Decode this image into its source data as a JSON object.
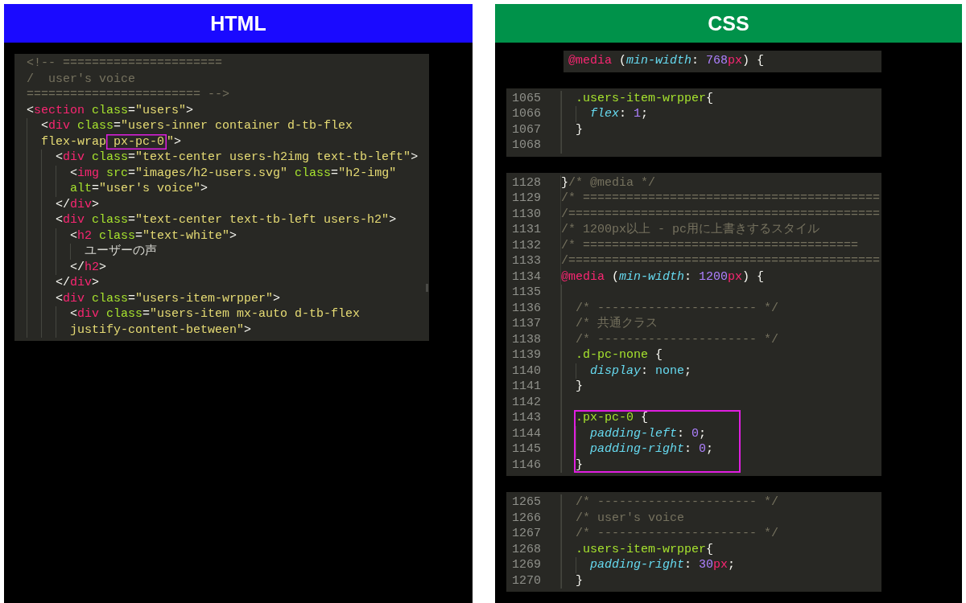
{
  "panes": [
    {
      "title": "HTML",
      "color": "#1a0aff",
      "kind": "markup",
      "snippets": [
        {
          "lines": [
            {
              "tokens": [
                {
                  "kind": "comment",
                  "text": "<!-- ======================"
                }
              ]
            },
            {
              "tokens": [
                {
                  "kind": "comment",
                  "text": "/  user's voice"
                }
              ]
            },
            {
              "tokens": [
                {
                  "kind": "comment",
                  "text": "======================== -->"
                }
              ]
            },
            {
              "tokens": [
                {
                  "kind": "punct",
                  "text": "<"
                },
                {
                  "kind": "tag",
                  "text": "section"
                },
                {
                  "kind": "attr",
                  "text": " class"
                },
                {
                  "kind": "punct",
                  "text": "="
                },
                {
                  "kind": "string",
                  "text": "\"users\""
                },
                {
                  "kind": "punct",
                  "text": ">"
                }
              ],
              "children": [
                {
                  "tokens": [
                    {
                      "kind": "punct",
                      "text": "<"
                    },
                    {
                      "kind": "tag",
                      "text": "div"
                    },
                    {
                      "kind": "attr",
                      "text": " class"
                    },
                    {
                      "kind": "punct",
                      "text": "="
                    },
                    {
                      "kind": "string",
                      "text": "\"users-inner container d-tb-flex"
                    }
                  ]
                },
                {
                  "tokens": [
                    {
                      "kind": "string",
                      "text": "flex-wrap"
                    },
                    {
                      "kind": "highlight",
                      "tokens": [
                        {
                          "kind": "string",
                          "text": " px-pc-0"
                        }
                      ]
                    },
                    {
                      "kind": "string",
                      "text": "\""
                    },
                    {
                      "kind": "punct",
                      "text": ">"
                    }
                  ],
                  "children": [
                    {
                      "tokens": [
                        {
                          "kind": "punct",
                          "text": "<"
                        },
                        {
                          "kind": "tag",
                          "text": "div"
                        },
                        {
                          "kind": "attr",
                          "text": " class"
                        },
                        {
                          "kind": "punct",
                          "text": "="
                        },
                        {
                          "kind": "string",
                          "text": "\"text-center users-h2img text-tb-left\""
                        },
                        {
                          "kind": "punct",
                          "text": ">"
                        }
                      ],
                      "children": [
                        {
                          "tokens": [
                            {
                              "kind": "punct",
                              "text": "<"
                            },
                            {
                              "kind": "tag",
                              "text": "img"
                            },
                            {
                              "kind": "attr",
                              "text": " src"
                            },
                            {
                              "kind": "punct",
                              "text": "="
                            },
                            {
                              "kind": "string",
                              "text": "\"images/h2-users.svg\""
                            },
                            {
                              "kind": "attr",
                              "text": " class"
                            },
                            {
                              "kind": "punct",
                              "text": "="
                            },
                            {
                              "kind": "string",
                              "text": "\"h2-img\""
                            }
                          ]
                        },
                        {
                          "tokens": [
                            {
                              "kind": "attr",
                              "text": "alt"
                            },
                            {
                              "kind": "punct",
                              "text": "="
                            },
                            {
                              "kind": "string",
                              "text": "\"user's voice\""
                            },
                            {
                              "kind": "punct",
                              "text": ">"
                            }
                          ]
                        }
                      ]
                    },
                    {
                      "tokens": [
                        {
                          "kind": "punct",
                          "text": "</"
                        },
                        {
                          "kind": "tag",
                          "text": "div"
                        },
                        {
                          "kind": "punct",
                          "text": ">"
                        }
                      ]
                    },
                    {
                      "tokens": [
                        {
                          "kind": "punct",
                          "text": "<"
                        },
                        {
                          "kind": "tag",
                          "text": "div"
                        },
                        {
                          "kind": "attr",
                          "text": " class"
                        },
                        {
                          "kind": "punct",
                          "text": "="
                        },
                        {
                          "kind": "string",
                          "text": "\"text-center text-tb-left users-h2\""
                        },
                        {
                          "kind": "punct",
                          "text": ">"
                        }
                      ],
                      "children": [
                        {
                          "tokens": [
                            {
                              "kind": "punct",
                              "text": "<"
                            },
                            {
                              "kind": "tag",
                              "text": "h2"
                            },
                            {
                              "kind": "attr",
                              "text": " class"
                            },
                            {
                              "kind": "punct",
                              "text": "="
                            },
                            {
                              "kind": "string",
                              "text": "\"text-white\""
                            },
                            {
                              "kind": "punct",
                              "text": ">"
                            }
                          ],
                          "children": [
                            {
                              "tokens": [
                                {
                                  "kind": "text",
                                  "text": "ユーザーの声"
                                }
                              ]
                            }
                          ]
                        },
                        {
                          "tokens": [
                            {
                              "kind": "punct",
                              "text": "</"
                            },
                            {
                              "kind": "tag",
                              "text": "h2"
                            },
                            {
                              "kind": "punct",
                              "text": ">"
                            }
                          ]
                        }
                      ]
                    },
                    {
                      "tokens": [
                        {
                          "kind": "punct",
                          "text": "</"
                        },
                        {
                          "kind": "tag",
                          "text": "div"
                        },
                        {
                          "kind": "punct",
                          "text": ">"
                        }
                      ]
                    },
                    {
                      "tokens": [
                        {
                          "kind": "punct",
                          "text": "<"
                        },
                        {
                          "kind": "tag",
                          "text": "div"
                        },
                        {
                          "kind": "attr",
                          "text": " class"
                        },
                        {
                          "kind": "punct",
                          "text": "="
                        },
                        {
                          "kind": "string",
                          "text": "\"users-item-wrpper\""
                        },
                        {
                          "kind": "punct",
                          "text": ">"
                        }
                      ],
                      "children": [
                        {
                          "tokens": [
                            {
                              "kind": "punct",
                              "text": "<"
                            },
                            {
                              "kind": "tag",
                              "text": "div"
                            },
                            {
                              "kind": "attr",
                              "text": " class"
                            },
                            {
                              "kind": "punct",
                              "text": "="
                            },
                            {
                              "kind": "string",
                              "text": "\"users-item mx-auto d-tb-flex"
                            }
                          ]
                        },
                        {
                          "tokens": [
                            {
                              "kind": "string",
                              "text": "justify-content-between\""
                            },
                            {
                              "kind": "punct",
                              "text": ">"
                            }
                          ]
                        }
                      ]
                    }
                  ]
                }
              ]
            }
          ]
        }
      ]
    },
    {
      "title": "CSS",
      "color": "#00924a",
      "kind": "stylesheet",
      "snippets": [
        {
          "lines": [
            {
              "tokens": [
                {
                  "kind": "at-rule",
                  "text": "@media"
                },
                {
                  "kind": "punct",
                  "text": " ("
                },
                {
                  "kind": "property",
                  "text": "min-width"
                },
                {
                  "kind": "punct",
                  "text": ": "
                },
                {
                  "kind": "number",
                  "text": "768"
                },
                {
                  "kind": "unit",
                  "text": "px"
                },
                {
                  "kind": "punct",
                  "text": ") {"
                }
              ]
            }
          ]
        },
        {
          "children": [
            {
              "number": "1065",
              "tokens": [
                {
                  "kind": "selector",
                  "text": ".users-item-wrpper"
                },
                {
                  "kind": "punct",
                  "text": "{"
                }
              ],
              "children": [
                {
                  "number": "1066",
                  "tokens": [
                    {
                      "kind": "property",
                      "text": "flex"
                    },
                    {
                      "kind": "punct",
                      "text": ": "
                    },
                    {
                      "kind": "number",
                      "text": "1"
                    },
                    {
                      "kind": "punct",
                      "text": ";"
                    }
                  ]
                }
              ]
            },
            {
              "number": "1067",
              "tokens": [
                {
                  "kind": "punct",
                  "text": "}"
                }
              ]
            },
            {
              "number": "1068"
            }
          ]
        },
        {
          "lines": [
            {
              "number": "1128",
              "tokens": [
                {
                  "kind": "punct",
                  "text": "}"
                },
                {
                  "kind": "comment",
                  "text": "/* @media */"
                }
              ]
            },
            {
              "number": "1129",
              "tokens": [
                {
                  "kind": "comment",
                  "text": "/* ========================================="
                }
              ]
            },
            {
              "number": "1130",
              "tokens": [
                {
                  "kind": "comment",
                  "text": "/==========================================="
                }
              ]
            },
            {
              "number": "1131",
              "tokens": [
                {
                  "kind": "comment",
                  "text": "/* 1200px以上 - pc用に上書きするスタイル"
                }
              ]
            },
            {
              "number": "1132",
              "tokens": [
                {
                  "kind": "comment",
                  "text": "/* ======================================"
                }
              ]
            },
            {
              "number": "1133",
              "tokens": [
                {
                  "kind": "comment",
                  "text": "/==========================================="
                }
              ]
            },
            {
              "number": "1134",
              "tokens": [
                {
                  "kind": "at-rule",
                  "text": "@media"
                },
                {
                  "kind": "punct",
                  "text": " ("
                },
                {
                  "kind": "property",
                  "text": "min-width"
                },
                {
                  "kind": "punct",
                  "text": ": "
                },
                {
                  "kind": "number",
                  "text": "1200"
                },
                {
                  "kind": "unit",
                  "text": "px"
                },
                {
                  "kind": "punct",
                  "text": ") {"
                }
              ],
              "children": [
                {
                  "kind": "line",
                  "number": "1135"
                },
                {
                  "kind": "line",
                  "number": "1136",
                  "tokens": [
                    {
                      "kind": "comment",
                      "text": "/* ---------------------- */"
                    }
                  ]
                },
                {
                  "kind": "line",
                  "number": "1137",
                  "tokens": [
                    {
                      "kind": "comment",
                      "text": "/* 共通クラス"
                    }
                  ]
                },
                {
                  "kind": "line",
                  "number": "1138",
                  "tokens": [
                    {
                      "kind": "comment",
                      "text": "/* ---------------------- */"
                    }
                  ]
                },
                {
                  "kind": "line",
                  "number": "1139",
                  "tokens": [
                    {
                      "kind": "selector",
                      "text": ".d-pc-none"
                    },
                    {
                      "kind": "punct",
                      "text": " {"
                    }
                  ],
                  "children": [
                    {
                      "number": "1140",
                      "tokens": [
                        {
                          "kind": "property",
                          "text": "display"
                        },
                        {
                          "kind": "punct",
                          "text": ": "
                        },
                        {
                          "kind": "value",
                          "text": "none"
                        },
                        {
                          "kind": "punct",
                          "text": ";"
                        }
                      ]
                    }
                  ]
                },
                {
                  "kind": "line",
                  "number": "1141",
                  "tokens": [
                    {
                      "kind": "punct",
                      "text": "}"
                    }
                  ]
                },
                {
                  "kind": "line",
                  "number": "1142"
                },
                {
                  "kind": "highlight",
                  "lines": [
                    {
                      "number": "1143",
                      "tokens": [
                        {
                          "kind": "selector",
                          "text": ".px-pc-0"
                        },
                        {
                          "kind": "punct",
                          "text": " {"
                        }
                      ],
                      "children": [
                        {
                          "number": "1144",
                          "tokens": [
                            {
                              "kind": "property",
                              "text": "padding-left"
                            },
                            {
                              "kind": "punct",
                              "text": ": "
                            },
                            {
                              "kind": "number",
                              "text": "0"
                            },
                            {
                              "kind": "punct",
                              "text": ";"
                            }
                          ]
                        },
                        {
                          "number": "1145",
                          "tokens": [
                            {
                              "kind": "property",
                              "text": "padding-right"
                            },
                            {
                              "kind": "punct",
                              "text": ": "
                            },
                            {
                              "kind": "number",
                              "text": "0"
                            },
                            {
                              "kind": "punct",
                              "text": ";"
                            }
                          ]
                        }
                      ]
                    },
                    {
                      "number": "1146",
                      "tokens": [
                        {
                          "kind": "punct",
                          "text": "}"
                        }
                      ]
                    }
                  ]
                }
              ]
            }
          ]
        },
        {
          "children": [
            {
              "number": "1265",
              "tokens": [
                {
                  "kind": "comment",
                  "text": "/* ---------------------- */"
                }
              ]
            },
            {
              "number": "1266",
              "tokens": [
                {
                  "kind": "comment",
                  "text": "/* user's voice"
                }
              ]
            },
            {
              "number": "1267",
              "tokens": [
                {
                  "kind": "comment",
                  "text": "/* ---------------------- */"
                }
              ]
            },
            {
              "number": "1268",
              "tokens": [
                {
                  "kind": "selector",
                  "text": ".users-item-wrpper"
                },
                {
                  "kind": "punct",
                  "text": "{"
                }
              ],
              "children": [
                {
                  "number": "1269",
                  "tokens": [
                    {
                      "kind": "property",
                      "text": "padding-right"
                    },
                    {
                      "kind": "punct",
                      "text": ": "
                    },
                    {
                      "kind": "number",
                      "text": "30"
                    },
                    {
                      "kind": "unit",
                      "text": "px"
                    },
                    {
                      "kind": "punct",
                      "text": ";"
                    }
                  ]
                }
              ]
            },
            {
              "number": "1270",
              "tokens": [
                {
                  "kind": "punct",
                  "text": "}"
                }
              ]
            }
          ]
        }
      ]
    }
  ]
}
